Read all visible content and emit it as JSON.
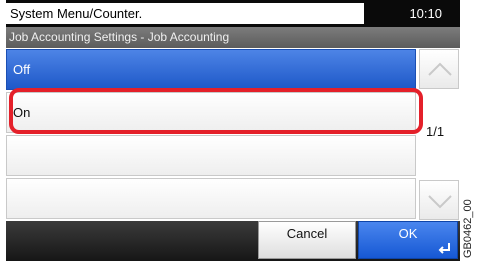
{
  "status_bar": {
    "title": "System Menu/Counter.",
    "time": "10:10"
  },
  "subheader": {
    "title": "Job Accounting Settings - Job Accounting"
  },
  "list": {
    "items": [
      {
        "label": "Off",
        "selected": true
      },
      {
        "label": "On",
        "selected": false
      },
      {
        "label": "",
        "selected": false
      },
      {
        "label": "",
        "selected": false
      }
    ],
    "page_indicator": "1/1"
  },
  "footer": {
    "cancel_label": "Cancel",
    "ok_label": "OK"
  },
  "figure_code": "GB0462_00",
  "colors": {
    "selected": "#1e58c8",
    "highlight": "#e4202a"
  },
  "icons": {
    "scroll_up": "chevron-up-icon",
    "scroll_down": "chevron-down-icon",
    "enter": "enter-icon"
  }
}
